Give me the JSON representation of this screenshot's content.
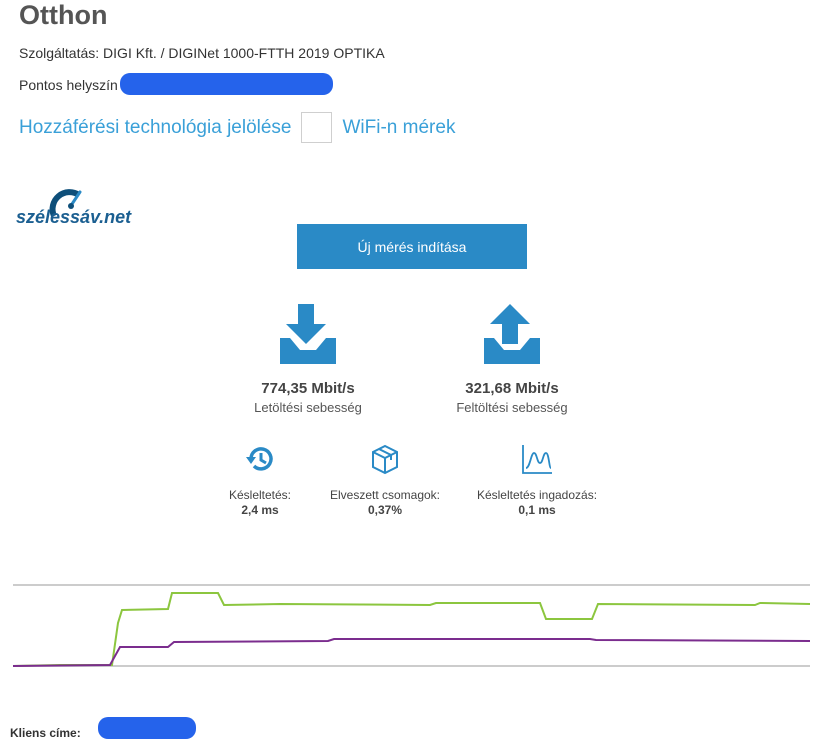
{
  "page": {
    "title": "Otthon",
    "service_text": "Szolgáltatás: DIGI Kft. / DIGINet 1000-FTTH 2019 OPTIKA",
    "location_label": "Pontos helyszín"
  },
  "links": {
    "access_tech": "Hozzáférési technológia jelölése",
    "wifi": "WiFi-n mérek"
  },
  "logo": {
    "text": "szélessáv.net"
  },
  "start_button": {
    "label": "Új mérés indítása"
  },
  "download": {
    "value": "774,35 Mbit/s",
    "label": "Letöltési sebesség",
    "icon": "download-tray-icon"
  },
  "upload": {
    "value": "321,68 Mbit/s",
    "label": "Feltöltési sebesség",
    "icon": "upload-tray-icon"
  },
  "metrics": [
    {
      "label": "Késleltetés:",
      "value": "2,4 ms",
      "icon": "history-clock-icon"
    },
    {
      "label": "Elveszett csomagok:",
      "value": "0,37%",
      "icon": "package-box-icon"
    },
    {
      "label": "Késleltetés ingadozás:",
      "value": "0,1 ms",
      "icon": "jitter-graph-icon"
    }
  ],
  "client": {
    "label": "Kliens címe:"
  },
  "colors": {
    "accent": "#2a8ac6",
    "link": "#3aa0d8",
    "icon": "#2a8ac6",
    "download_line": "#8cc63f",
    "upload_line": "#7b2d8e",
    "redaction": "#2563eb"
  }
}
